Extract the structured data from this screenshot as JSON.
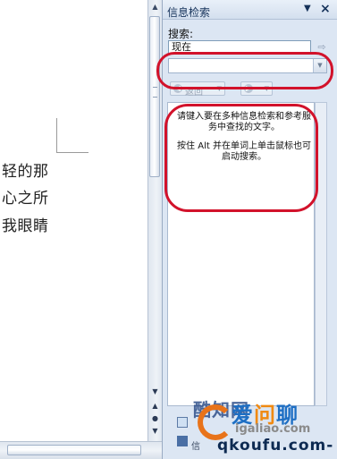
{
  "document": {
    "lines": [
      "轻的那",
      "心之所",
      "我眼睛"
    ]
  },
  "pane": {
    "title": "信息检索",
    "menu_glyph": "▼",
    "close_glyph": "×",
    "search_label": "搜索:",
    "search_value": "现在",
    "go_glyph": "⇨",
    "source_value": "",
    "back_label": "返回",
    "results": {
      "paragraph_1": "请键入要在多种信息检索和参考服务中查找的文字。",
      "paragraph_2": "按住 Alt 并在单词上单击鼠标也可启动搜索。"
    },
    "footer_text": "信"
  },
  "brand_logo_text": "酷知网",
  "watermark": {
    "big_pre": "爱",
    "big_mid": "问",
    "big_post": "聊",
    "small": "igaliao.com",
    "bottom": "qkoufu.com-"
  },
  "colors": {
    "annotation": "#d2122b",
    "pane_bg": "#dce6f3",
    "accent": "#1e6fc4"
  }
}
